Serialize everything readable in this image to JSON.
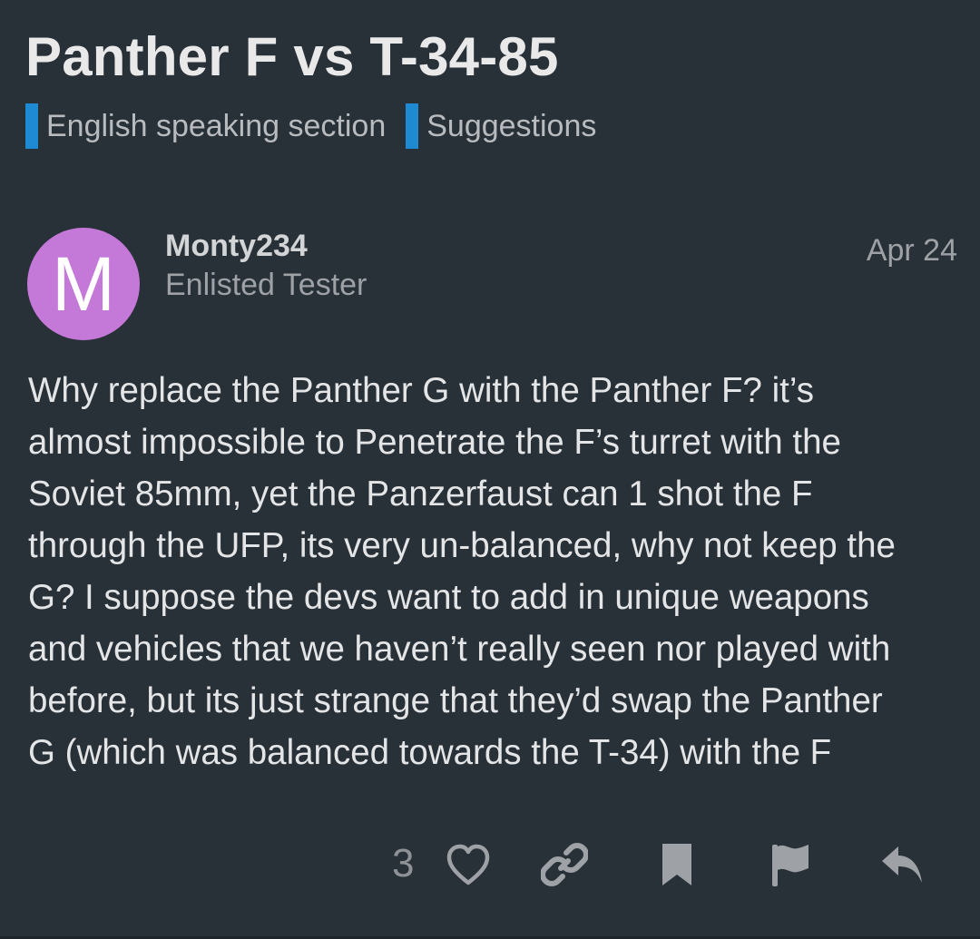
{
  "topic": {
    "title": "Panther F vs T-34-85",
    "categories": [
      {
        "label": "English speaking section",
        "color": "#1e8ad2"
      },
      {
        "label": "Suggestions",
        "color": "#1e8ad2"
      }
    ]
  },
  "post": {
    "avatar_letter": "M",
    "avatar_color": "#c478d8",
    "username": "Monty234",
    "user_title": "Enlisted Tester",
    "date": "Apr 24",
    "body_lines": [
      "Why replace the Panther G with the Panther F? it’s",
      "almost impossible to Penetrate the F’s turret with the",
      "Soviet 85mm, yet the Panzerfaust can 1 shot the F",
      "through the UFP, its very un-balanced, why not keep the",
      "G? I suppose the devs want to add in unique weapons",
      "and vehicles that we haven’t really seen nor played with",
      "before, but its just strange that they’d swap the Panther",
      "G (which was balanced towards the T-34) with the F"
    ],
    "like_count": "3",
    "actions": [
      "heart-icon",
      "link-icon",
      "bookmark-icon",
      "flag-icon",
      "reply-icon"
    ]
  }
}
